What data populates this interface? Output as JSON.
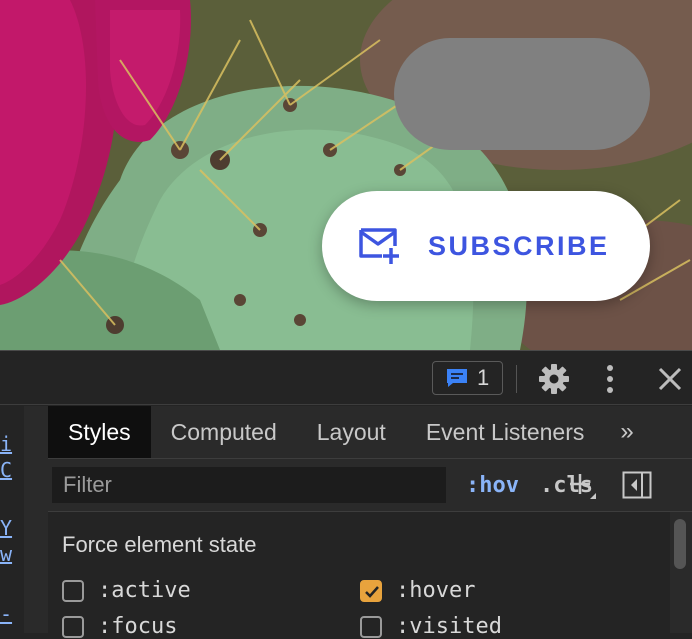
{
  "hero": {
    "subscribe_button": {
      "label": "SUBSCRIBE",
      "icon": "mail-add-icon"
    }
  },
  "devtools": {
    "toolbar": {
      "issues_count": "1"
    },
    "gutter_links": [
      "i",
      "C",
      "Y",
      "w",
      "-"
    ],
    "tabs": [
      {
        "label": "Styles",
        "active": true
      },
      {
        "label": "Computed",
        "active": false
      },
      {
        "label": "Layout",
        "active": false
      },
      {
        "label": "Event Listeners",
        "active": false
      }
    ],
    "tab_overflow": "»",
    "filter": {
      "placeholder": "Filter",
      "hov_label": ":hov",
      "cls_label": ".cls"
    },
    "force_state": {
      "title": "Force element state",
      "options": [
        {
          "label": ":active",
          "checked": false
        },
        {
          "label": ":hover",
          "checked": true
        },
        {
          "label": ":focus",
          "checked": false
        },
        {
          "label": ":visited",
          "checked": false
        }
      ]
    }
  },
  "colors": {
    "accent_blue": "#3d55e0",
    "devtools_link": "#8ab4f8",
    "checkbox_checked": "#e8a33d",
    "devtools_bg": "#242424"
  }
}
